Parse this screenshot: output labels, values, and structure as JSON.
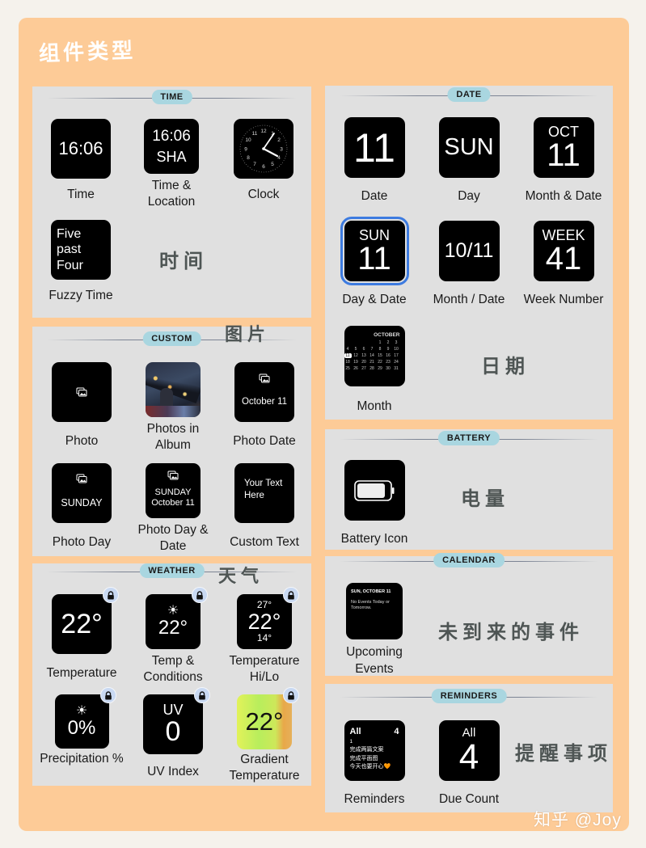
{
  "page": {
    "title": "组件类型",
    "watermark": "知乎 @Joy"
  },
  "colors": {
    "background": "#f5f2ec",
    "card": "#fdcb97",
    "panel": "#e0e0e0",
    "pill": "#a9d6e0",
    "selected_outline": "#3d7be0",
    "lock_badge": "#c9d9f2",
    "note_text": "#4e5554"
  },
  "sections": {
    "time": {
      "title": "TIME",
      "note": "时间",
      "widgets": [
        {
          "label": "Time",
          "display": "16:06"
        },
        {
          "label": "Time & Location",
          "display": "16:06",
          "sub": "SHA"
        },
        {
          "label": "Clock",
          "icon": "analog-clock-icon",
          "display_time": "4:06"
        },
        {
          "label": "Fuzzy Time",
          "lines": [
            "Five",
            "past",
            "Four"
          ]
        }
      ]
    },
    "custom": {
      "title": "CUSTOM",
      "note": "图片",
      "widgets": [
        {
          "label": "Photo",
          "icon": "photo-stack-icon"
        },
        {
          "label": "Photos in Album",
          "image": "night-photo"
        },
        {
          "label": "Photo Date",
          "icon": "photo-stack-icon",
          "display": "October 11"
        },
        {
          "label": "Photo Day",
          "icon": "photo-stack-icon",
          "display": "SUNDAY"
        },
        {
          "label": "Photo Day & Date",
          "icon": "photo-stack-icon",
          "display": "SUNDAY",
          "sub": "October 11"
        },
        {
          "label": "Custom Text",
          "display": "Your Text Here"
        }
      ]
    },
    "weather": {
      "title": "WEATHER",
      "note": "天气",
      "widgets": [
        {
          "label": "Temperature",
          "display": "22°",
          "locked": true
        },
        {
          "label": "Temp & Conditions",
          "icon": "sun-icon",
          "display": "22°",
          "locked": true
        },
        {
          "label": "Temperature Hi/Lo",
          "hi": "27°",
          "display": "22°",
          "lo": "14°",
          "locked": true
        },
        {
          "label": "Precipitation %",
          "icon": "sun-icon",
          "display": "0%",
          "locked": true
        },
        {
          "label": "UV Index",
          "top": "UV",
          "display": "0",
          "locked": true
        },
        {
          "label": "Gradient Temperature",
          "display": "22°",
          "locked": true
        }
      ]
    },
    "date": {
      "title": "DATE",
      "note": "日期",
      "widgets": [
        {
          "label": "Date",
          "display": "11"
        },
        {
          "label": "Day",
          "display": "SUN"
        },
        {
          "label": "Month & Date",
          "top": "OCT",
          "display": "11"
        },
        {
          "label": "Day & Date",
          "top": "SUN",
          "display": "11",
          "selected": true
        },
        {
          "label": "Month / Date",
          "display": "10/11"
        },
        {
          "label": "Week Number",
          "top": "WEEK",
          "display": "41"
        },
        {
          "label": "Month",
          "month": "OCTOBER",
          "days": [
            "",
            "",
            "",
            "",
            "1",
            "2",
            "3",
            "4",
            "5",
            "6",
            "7",
            "8",
            "9",
            "10",
            "11",
            "12",
            "13",
            "14",
            "15",
            "16",
            "17",
            "18",
            "19",
            "20",
            "21",
            "22",
            "23",
            "24",
            "25",
            "26",
            "27",
            "28",
            "29",
            "30",
            "31"
          ],
          "today": "11"
        }
      ]
    },
    "battery": {
      "title": "BATTERY",
      "note": "电量",
      "widgets": [
        {
          "label": "Battery Icon",
          "icon": "battery-icon"
        }
      ]
    },
    "calendar": {
      "title": "CALENDAR",
      "note": "未到来的事件",
      "widgets": [
        {
          "label": "Upcoming Events",
          "header": "SUN, OCTOBER 11",
          "body": "No Events Today or Tomorrow."
        }
      ]
    },
    "reminders": {
      "title": "REMINDERS",
      "note": "提醒事项",
      "widgets": [
        {
          "label": "Reminders",
          "list": "All",
          "count": "4",
          "items": [
            "1",
            "完成两篇文案",
            "完成平面图",
            "今天也要开心🧡"
          ]
        },
        {
          "label": "Due Count",
          "top": "All",
          "display": "4"
        }
      ]
    }
  }
}
